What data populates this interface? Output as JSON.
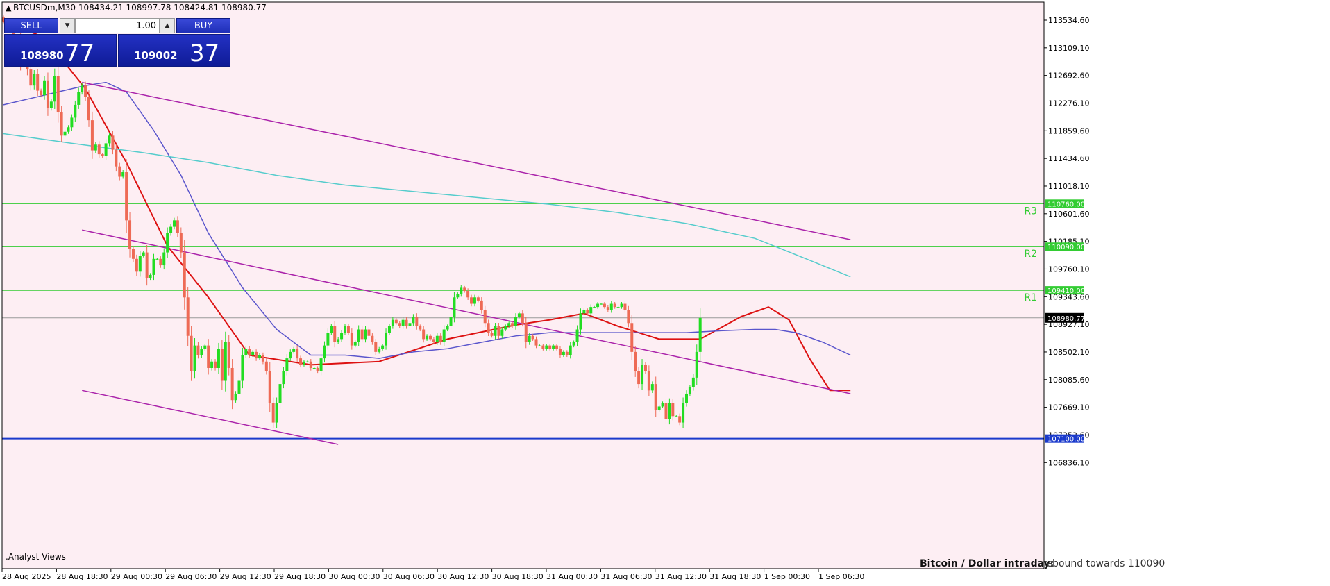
{
  "header": {
    "symbol_info": "BTCUSDm,M30  108434.21 108997.78 108424.81 108980.77"
  },
  "trade_panel": {
    "sell_label": "SELL",
    "buy_label": "BUY",
    "volume": "1.00",
    "bid_main": "108980",
    "bid_big": "77",
    "ask_main": "109002",
    "ask_big": "37"
  },
  "footer": {
    "analyst_label": ".Analyst Views",
    "caption_title": "Bitcoin / Dollar intraday:",
    "caption_text": "rebound towards 110090"
  },
  "colors": {
    "background": "#fdeef3",
    "bull_candle": "#22dd22",
    "bear_candle": "#ee6a55",
    "ma_fast": "#dd1111",
    "ma_mid": "#5a55cc",
    "ma_slow": "#55cccc",
    "channel": "#aa22aa",
    "levels": "#33cc33",
    "support_line": "#1a3acc"
  },
  "chart_data": {
    "type": "candlestick",
    "symbol": "BTCUSDm",
    "timeframe": "M30",
    "ylim": [
      107010,
      113900
    ],
    "y_ticks": [
      113534.6,
      113109.1,
      112692.6,
      112276.1,
      111859.6,
      111434.6,
      111018.1,
      110601.6,
      110185.1,
      109760.1,
      109343.6,
      108927.1,
      108502.1,
      108085.6,
      107669.1,
      107252.6,
      106836.1
    ],
    "y_tick_labels": [
      "113534.60",
      "113109.10",
      "112692.60",
      "112276.10",
      "111859.60",
      "111434.60",
      "111018.10",
      "110601.60",
      "110185.10",
      "109760.10",
      "109343.60",
      "108927.10",
      "108502.10",
      "108085.60",
      "107669.10",
      "107252.60",
      "106836.10"
    ],
    "x_tick_labels": [
      "28 Aug 2025",
      "28 Aug 18:30",
      "29 Aug 00:30",
      "29 Aug 06:30",
      "29 Aug 12:30",
      "29 Aug 18:30",
      "30 Aug 00:30",
      "30 Aug 06:30",
      "30 Aug 12:30",
      "30 Aug 18:30",
      "31 Aug 00:30",
      "31 Aug 06:30",
      "31 Aug 12:30",
      "31 Aug 18:30",
      "1 Sep 00:30",
      "1 Sep 06:30"
    ],
    "levels": [
      {
        "name": "R3",
        "value": 110760.0,
        "label": "110760.00"
      },
      {
        "name": "R2",
        "value": 110090.0,
        "label": "110090.00"
      },
      {
        "name": "R1",
        "value": 109410.0,
        "label": "109410.00"
      },
      {
        "name": "",
        "value": 107100.0,
        "label": "107100.00"
      }
    ],
    "current_price": {
      "value": 108980.77,
      "label": "108980.77"
    },
    "candles_close": [
      113600,
      113550,
      113470,
      113250,
      113350,
      112950,
      113150,
      112850,
      112600,
      112780,
      112520,
      112450,
      112680,
      112250,
      112350,
      112750,
      112180,
      111820,
      111880,
      111950,
      112100,
      112300,
      112500,
      112600,
      112420,
      112060,
      111590,
      111680,
      111530,
      111500,
      111700,
      111820,
      111600,
      111340,
      111180,
      111250,
      110500,
      110050,
      109900,
      109700,
      109950,
      110000,
      109600,
      109650,
      109900,
      109900,
      109800,
      110000,
      110300,
      110400,
      110500,
      110300,
      110000,
      109300,
      108700,
      108150,
      108550,
      108400,
      108500,
      108550,
      108200,
      108300,
      108200,
      108500,
      108000,
      108600,
      108200,
      107700,
      107800,
      108000,
      108400,
      108500,
      108400,
      108450,
      108350,
      108400,
      108300,
      108150,
      107650,
      107350,
      107650,
      107950,
      108150,
      108350,
      108450,
      108500,
      108350,
      108250,
      108300,
      108300,
      108200,
      108200,
      108150,
      108350,
      108550,
      108750,
      108850,
      108600,
      108650,
      108750,
      108850,
      108750,
      108550,
      108600,
      108800,
      108650,
      108800,
      108700,
      108600,
      108450,
      108500,
      108550,
      108750,
      108850,
      108950,
      108900,
      108850,
      108950,
      108850,
      108900,
      109000,
      108850,
      108800,
      108650,
      108700,
      108650,
      108600,
      108700,
      108600,
      108800,
      108850,
      109000,
      109300,
      109350,
      109450,
      109400,
      109300,
      109200,
      109300,
      109250,
      109100,
      108900,
      108750,
      108700,
      108850,
      108700,
      108800,
      108850,
      108900,
      108850,
      109000,
      109050,
      108900,
      108600,
      108700,
      108650,
      108550,
      108550,
      108500,
      108550,
      108500,
      108550,
      108500,
      108400,
      108450,
      108400,
      108550,
      108600,
      108800,
      109050,
      109100,
      109050,
      109150,
      109150,
      109200,
      109200,
      109150,
      109100,
      109200,
      109150,
      109150,
      109200,
      109100,
      108900,
      108450,
      108150,
      107950,
      108250,
      108150,
      107850,
      107950,
      107550,
      107600,
      107650,
      107400,
      107650,
      107450,
      107450,
      107350,
      107650,
      107800,
      107900,
      108050,
      108450,
      108981
    ],
    "series": [
      {
        "name": "ma-fast",
        "points": [
          [
            0,
            113600
          ],
          [
            12,
            113350
          ],
          [
            24,
            112550
          ],
          [
            36,
            111400
          ],
          [
            48,
            110100
          ],
          [
            60,
            109300
          ],
          [
            72,
            108400
          ],
          [
            90,
            108250
          ],
          [
            110,
            108300
          ],
          [
            130,
            108650
          ],
          [
            150,
            108870
          ],
          [
            160,
            108950
          ],
          [
            170,
            109050
          ],
          [
            180,
            108850
          ],
          [
            192,
            108650
          ],
          [
            204,
            108650
          ],
          [
            216,
            109000
          ],
          [
            224,
            109150
          ],
          [
            230,
            108950
          ],
          [
            236,
            108350
          ],
          [
            242,
            107850
          ],
          [
            248,
            107850
          ]
        ]
      },
      {
        "name": "ma-mid",
        "points": [
          [
            0,
            112300
          ],
          [
            8,
            112400
          ],
          [
            16,
            112500
          ],
          [
            24,
            112600
          ],
          [
            30,
            112650
          ],
          [
            36,
            112500
          ],
          [
            44,
            111900
          ],
          [
            52,
            111200
          ],
          [
            60,
            110300
          ],
          [
            70,
            109450
          ],
          [
            80,
            108800
          ],
          [
            90,
            108400
          ],
          [
            100,
            108400
          ],
          [
            110,
            108350
          ],
          [
            120,
            108450
          ],
          [
            130,
            108500
          ],
          [
            140,
            108600
          ],
          [
            150,
            108700
          ],
          [
            160,
            108750
          ],
          [
            170,
            108750
          ],
          [
            180,
            108750
          ],
          [
            190,
            108750
          ],
          [
            200,
            108750
          ],
          [
            210,
            108780
          ],
          [
            220,
            108800
          ],
          [
            226,
            108800
          ],
          [
            232,
            108750
          ],
          [
            240,
            108600
          ],
          [
            248,
            108400
          ]
        ]
      },
      {
        "name": "ma-slow",
        "points": [
          [
            0,
            111850
          ],
          [
            20,
            111700
          ],
          [
            40,
            111560
          ],
          [
            60,
            111400
          ],
          [
            80,
            111200
          ],
          [
            100,
            111050
          ],
          [
            130,
            110900
          ],
          [
            160,
            110750
          ],
          [
            180,
            110620
          ],
          [
            200,
            110450
          ],
          [
            220,
            110220
          ],
          [
            236,
            109880
          ],
          [
            248,
            109620
          ]
        ]
      },
      {
        "name": "channel-upper",
        "points": [
          [
            23,
            112650
          ],
          [
            248,
            110200
          ]
        ]
      },
      {
        "name": "channel-middle",
        "points": [
          [
            23,
            110350
          ],
          [
            248,
            107800
          ]
        ]
      },
      {
        "name": "channel-lower",
        "points": [
          [
            23,
            107850
          ],
          [
            98,
            107010
          ]
        ]
      }
    ]
  }
}
